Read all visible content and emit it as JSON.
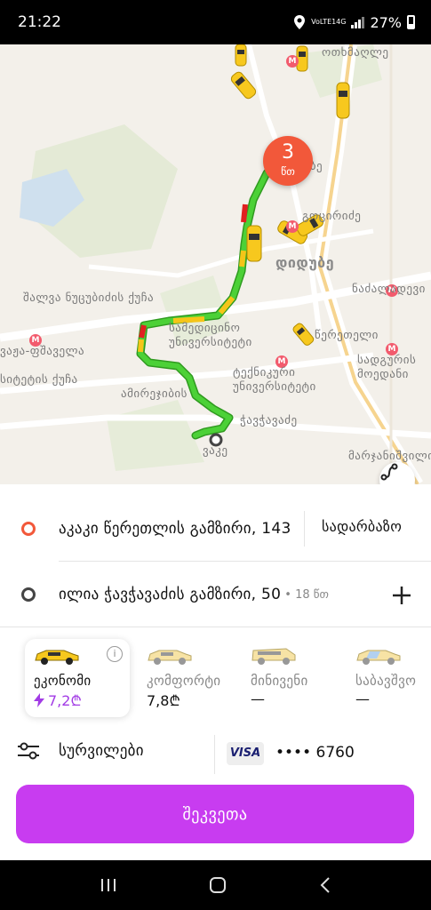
{
  "status_bar": {
    "time": "21:22",
    "network_volte": "VoLTE1",
    "network_4g": "4G",
    "battery": "27%"
  },
  "map": {
    "eta_badge": {
      "value": "3",
      "unit": "წთ"
    },
    "labels": {
      "tsereteli_top": "ოთხმაღლე",
      "didube_small": "დიდუბე",
      "didube_big": "დიდუბე",
      "gotsiridze": "გოცირიძე",
      "nadzaladevi": "ნაძალადევი",
      "tsereteli_metro": "წერეთელი",
      "station_square": "სადგურის მოედანი",
      "medical_university": "სამედიცინო უნივერსიტეტი",
      "technical_university": "ტექნიკური უნივერსიტეტი",
      "delisi": "დელისი",
      "vazha_pshavela": "ვაჟა-ფშაველა",
      "university_street": "სიტეტის ქუჩა",
      "chavchavadze": "ჭავჭავაძე",
      "vake": "ვაკე",
      "marjanishvili": "მარჯანიშვილი",
      "nutsubidze": "შალვა ნუცუბიძის ქუჩა",
      "amirejibi": "ამირეჯიბის"
    }
  },
  "route": {
    "origin": "აკაკი წერეთლის გამზირი, 143",
    "entrance_button": "სადარბაზო",
    "destination": "ილია ჭავჭავაძის გამზირი, 50",
    "destination_eta": "• 18 წთ"
  },
  "tariffs": [
    {
      "name": "ეკონომი",
      "price": "7,2₾",
      "selected": true,
      "surge": true
    },
    {
      "name": "კომფორტი",
      "price": "7,8₾",
      "selected": false,
      "surge": false
    },
    {
      "name": "მინივენი",
      "price": "—",
      "selected": false,
      "surge": false
    },
    {
      "name": "საბავშვო",
      "price": "—",
      "selected": false,
      "surge": false
    }
  ],
  "options": {
    "wishes_label": "სურვილები",
    "card_brand": "VISA",
    "card_masked": "•••• 6760"
  },
  "order_button": "შეკვეთა",
  "colors": {
    "accent": "#c83cf0",
    "origin": "#f2583a",
    "route_green": "#4cd137",
    "route_yellow": "#f5c518",
    "route_red": "#e02020",
    "taxi": "#f7c81e"
  }
}
